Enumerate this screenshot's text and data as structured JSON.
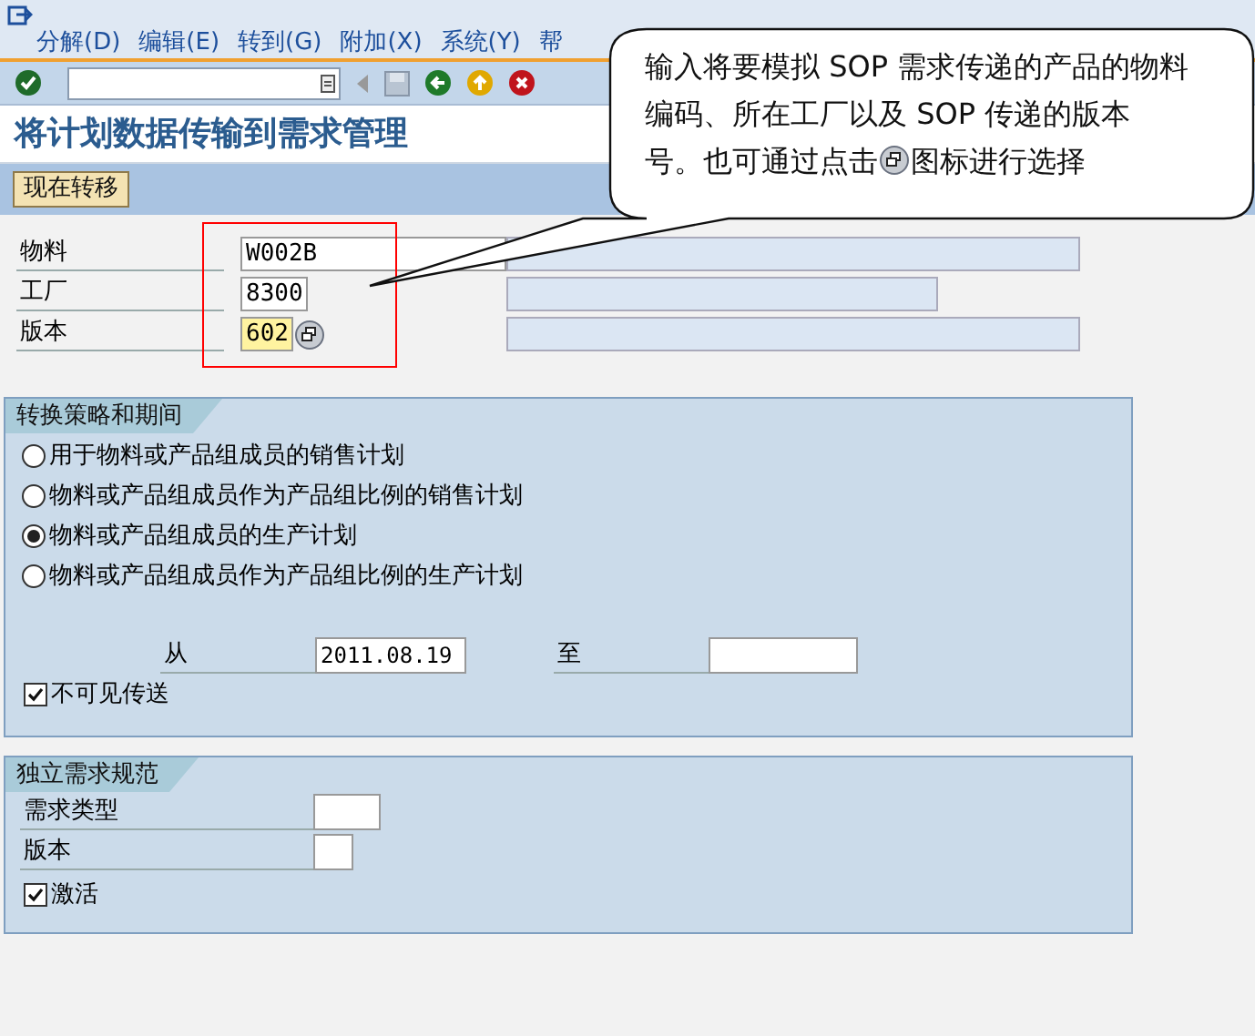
{
  "menu": [
    "分解(D)",
    "编辑(E)",
    "转到(G)",
    "附加(X)",
    "系统(Y)",
    "帮"
  ],
  "title": "将计划数据传输到需求管理",
  "action_button": "现在转移",
  "header_fields": [
    {
      "label": "物料",
      "value": "W002B",
      "focused": false,
      "has_help": false
    },
    {
      "label": "工厂",
      "value": "8300",
      "focused": false,
      "has_help": false
    },
    {
      "label": "版本",
      "value": "602",
      "focused": true,
      "has_help": true
    }
  ],
  "strategy_group": {
    "title": "转换策略和期间",
    "options": [
      {
        "label": "用于物料或产品组成员的销售计划",
        "selected": false
      },
      {
        "label": "物料或产品组成员作为产品组比例的销售计划",
        "selected": false
      },
      {
        "label": "物料或产品组成员的生产计划",
        "selected": true
      },
      {
        "label": "物料或产品组成员作为产品组比例的生产计划",
        "selected": false
      }
    ],
    "from_label": "从",
    "from_value": "2011.08.19",
    "to_label": "至",
    "invisible_transfer": {
      "label": "不可见传送",
      "checked": true
    }
  },
  "requirements_group": {
    "title": "独立需求规范",
    "fields": [
      {
        "label": "需求类型"
      },
      {
        "label": "版本"
      }
    ],
    "activate": {
      "label": "激活",
      "checked": true
    }
  },
  "callout": {
    "text_lines": "输入将要模拟 SOP 需求传递的产品的物料编码、所在工厂以及 SOP 传递的版本",
    "text_before_icon": "号。也可通过点击",
    "text_after_icon": "图标进行选择"
  }
}
